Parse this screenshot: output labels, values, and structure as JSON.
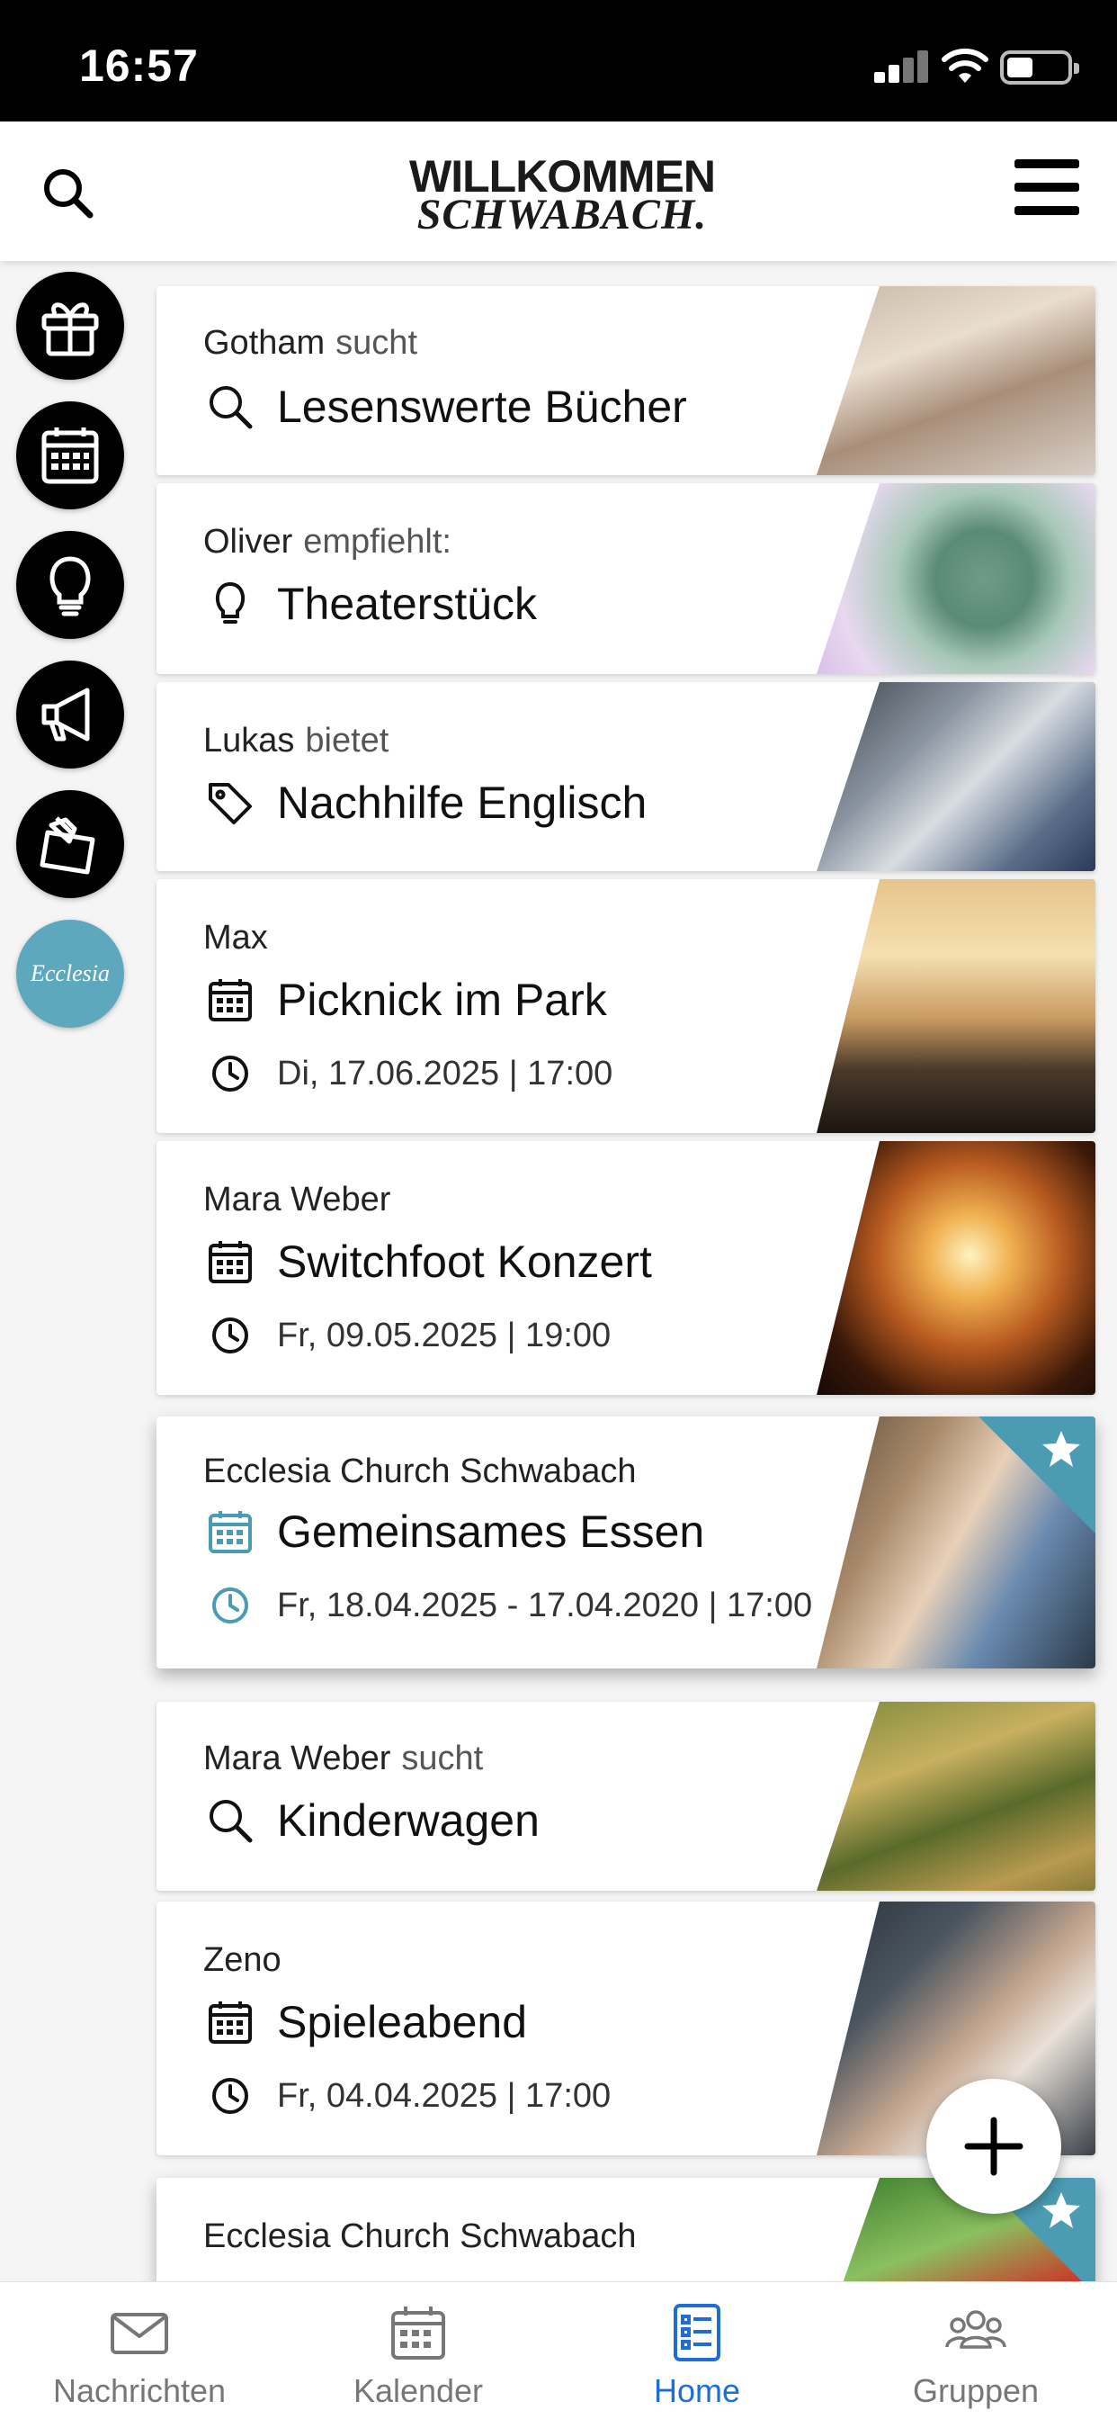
{
  "status_bar": {
    "time": "16:57"
  },
  "header": {
    "logo_line1": "WILLKOMMEN",
    "logo_line2": "SCHWABACH."
  },
  "rail": {
    "items": [
      {
        "icon": "gift-icon"
      },
      {
        "icon": "calendar-icon"
      },
      {
        "icon": "lightbulb-icon"
      },
      {
        "icon": "megaphone-icon"
      },
      {
        "icon": "pin-note-icon"
      },
      {
        "icon": "ecclesia-logo",
        "label": "Ecclesia"
      }
    ]
  },
  "cards": [
    {
      "who": "Gotham",
      "verb": "sucht",
      "title": "Lesenswerte Bücher",
      "icon": "search-icon"
    },
    {
      "who": "Oliver",
      "verb": "empfiehlt:",
      "title": "Theaterstück",
      "icon": "lightbulb-icon"
    },
    {
      "who": "Lukas",
      "verb": "bietet",
      "title": "Nachhilfe Englisch",
      "icon": "tag-icon"
    },
    {
      "who": "Max",
      "verb": "",
      "title": "Picknick im Park",
      "icon": "calendar-icon",
      "date": "Di, 17.06.2025 | 17:00"
    },
    {
      "who": "Mara Weber",
      "verb": "",
      "title": "Switchfoot Konzert",
      "icon": "calendar-icon",
      "date": "Fr, 09.05.2025 | 19:00"
    },
    {
      "who": "Ecclesia Church Schwabach",
      "verb": "",
      "title": "Gemeinsames Essen",
      "icon": "calendar-icon",
      "date": "Fr, 18.04.2025 - 17.04.2020 | 17:00",
      "featured": true
    },
    {
      "who": "Mara Weber",
      "verb": "sucht",
      "title": "Kinderwagen",
      "icon": "search-icon"
    },
    {
      "who": "Zeno",
      "verb": "",
      "title": "Spieleabend",
      "icon": "calendar-icon",
      "date": "Fr, 04.04.2025 | 17:00"
    },
    {
      "who": "Ecclesia Church Schwabach",
      "verb": "",
      "title": "",
      "featured": true
    }
  ],
  "tabs": [
    {
      "label": "Nachrichten",
      "icon": "mail-icon"
    },
    {
      "label": "Kalender",
      "icon": "calendar-icon"
    },
    {
      "label": "Home",
      "icon": "list-icon",
      "active": true
    },
    {
      "label": "Gruppen",
      "icon": "group-icon"
    }
  ],
  "colors": {
    "accent_blue": "#1e6ed6",
    "featured_teal": "#4b9bb3",
    "tab_inactive": "#777777"
  }
}
